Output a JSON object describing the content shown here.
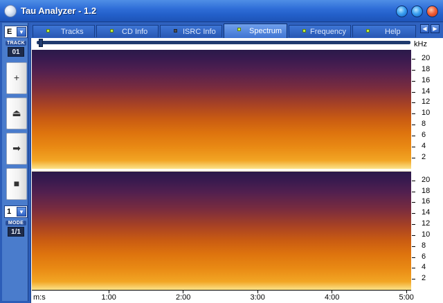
{
  "window": {
    "title": "Tau Analyzer - 1.2",
    "colors": {
      "titlebar": "#2f6ed8",
      "frame": "#2c5db8",
      "active_tab": "#6fa0ec",
      "tab_dot_on": "#c0ef48"
    }
  },
  "left_panel": {
    "drive_select": "E",
    "track_label": "TRACK",
    "track_value": "01",
    "buttons": [
      {
        "icon": "plus-icon",
        "glyph": "+"
      },
      {
        "icon": "eject-icon",
        "glyph": "⏏"
      },
      {
        "icon": "play-icon",
        "glyph": "➡"
      },
      {
        "icon": "stop-icon",
        "glyph": "■"
      }
    ],
    "mode_select": "1",
    "mode_label": "MODE",
    "mode_value": "1/1"
  },
  "tabs": [
    {
      "label": "Tracks",
      "indicator": "on"
    },
    {
      "label": "CD Info",
      "indicator": "on"
    },
    {
      "label": "ISRC Info",
      "indicator": "off"
    },
    {
      "label": "Spectrum",
      "indicator": "on",
      "active": true
    },
    {
      "label": "Frequency",
      "indicator": "on"
    },
    {
      "label": "Help",
      "indicator": "on"
    }
  ],
  "tab_nav": {
    "prev_icon": "chevron-left-icon",
    "next_icon": "chevron-right-icon"
  },
  "spectrum": {
    "y_unit": "kHz",
    "channel_count": 2,
    "y_ticks": [
      "20",
      "18",
      "16",
      "14",
      "12",
      "10",
      "8",
      "6",
      "4",
      "2"
    ],
    "x_axis_label": "m:s",
    "x_ticks": [
      "1:00",
      "2:00",
      "3:00",
      "4:00",
      "5:00"
    ],
    "scroll_position": 0.01
  }
}
